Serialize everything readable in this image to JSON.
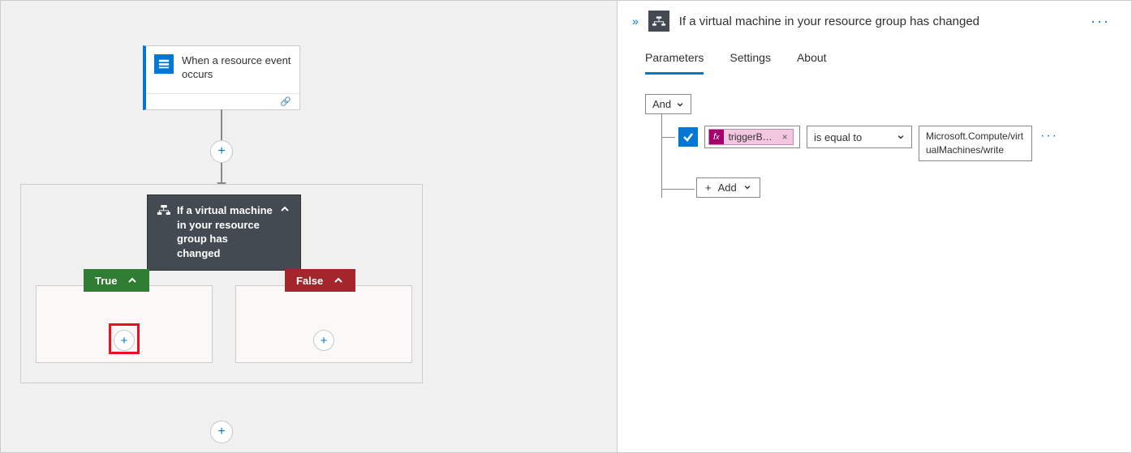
{
  "canvas": {
    "trigger": {
      "title": "When a resource event occurs"
    },
    "condition": {
      "title": "If a virtual machine in your resource group has changed"
    },
    "branches": {
      "true_label": "True",
      "false_label": "False"
    }
  },
  "panel": {
    "title": "If a virtual machine in your resource group has changed",
    "tabs": {
      "parameters": "Parameters",
      "settings": "Settings",
      "about": "About",
      "active": "parameters"
    },
    "editor": {
      "group_op": "And",
      "rows": [
        {
          "token_label": "triggerB…",
          "operator": "is equal to",
          "value": "Microsoft.Compute/virtualMachines/write"
        }
      ],
      "add_label": "Add"
    }
  }
}
